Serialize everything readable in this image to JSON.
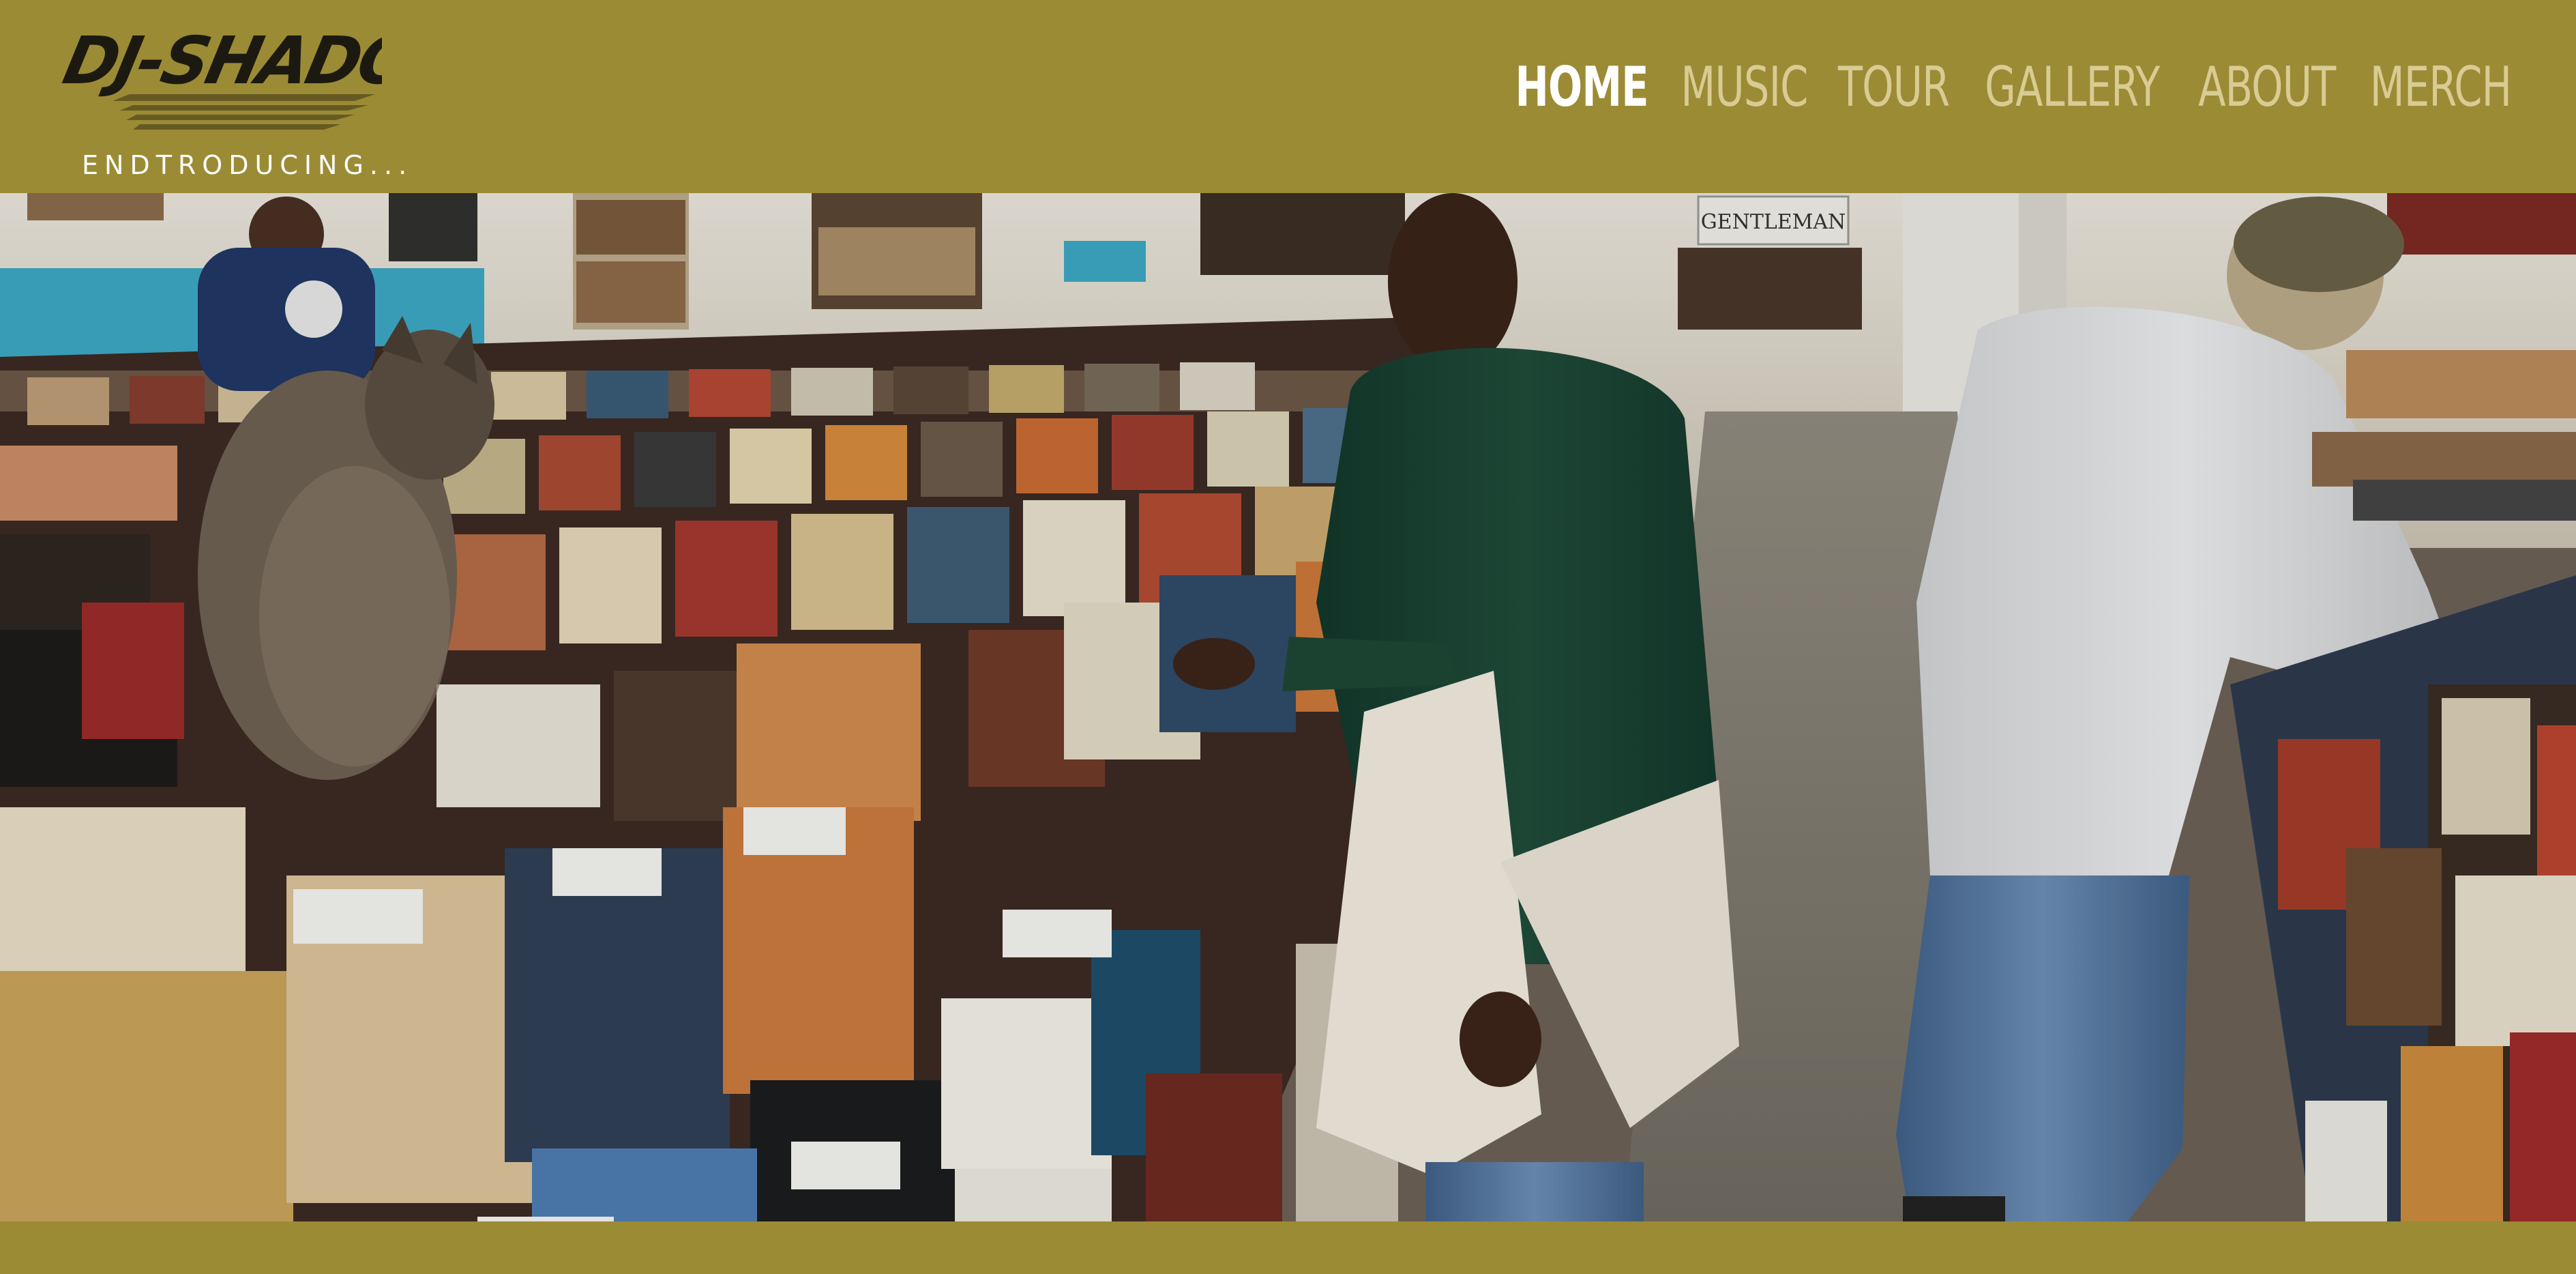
{
  "brand": {
    "logo_text": "DJ-SHADOW",
    "tagline": "ENDTRODUCING...",
    "colors": {
      "header_bg": "#9b8b35",
      "nav_inactive": "#d8cc93",
      "nav_active": "#ffffff"
    }
  },
  "nav": {
    "items": [
      {
        "label": "HOME",
        "active": true
      },
      {
        "label": "MUSIC",
        "active": false
      },
      {
        "label": "TOUR",
        "active": false
      },
      {
        "label": "GALLERY",
        "active": false
      },
      {
        "label": "ABOUT",
        "active": false
      },
      {
        "label": "MERCH",
        "active": false
      }
    ]
  },
  "hero": {
    "banner_text": "GENTLEMAN"
  }
}
